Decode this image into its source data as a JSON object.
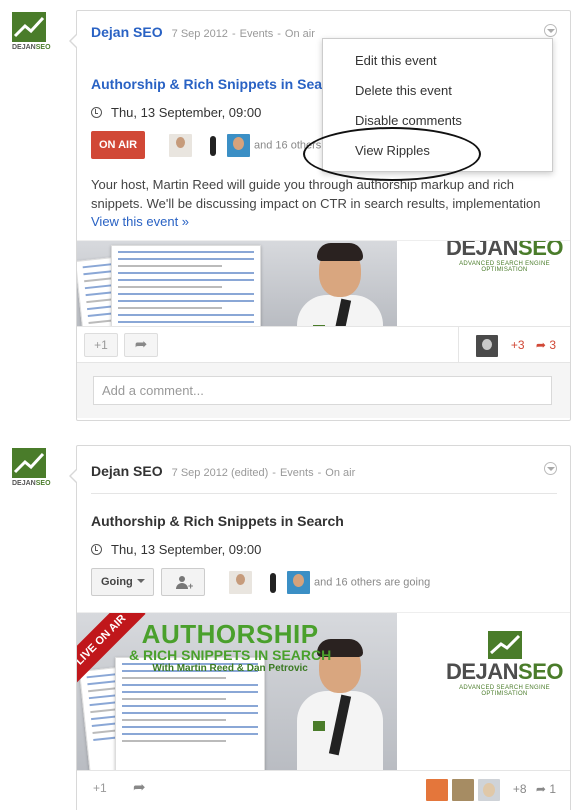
{
  "posts": [
    {
      "logo_text_a": "DEJAN",
      "logo_text_b": "SEO",
      "author": "Dejan SEO",
      "date": "7 Sep 2012",
      "category": "Events",
      "status": "On air",
      "title": "Authorship & Rich Snippets in Search",
      "when": "Thu, 13 September, 09:00",
      "action_label": "ON AIR",
      "attendees_text": "and 16 others",
      "description": "Your host, Martin Reed will guide you through authorship markup and rich snippets. We'll be discussing impact on CTR in search results, implementation",
      "view_link": "View this event »",
      "brand_a": "DEJAN",
      "brand_b": "SEO",
      "brand_sub": "ADVANCED SEARCH ENGINE OPTIMISATION",
      "plus_one": "+1",
      "plus_count": "+3",
      "share_count": "3",
      "comment_placeholder": "Add a comment...",
      "menu": [
        "Edit this event",
        "Delete this event",
        "Disable comments",
        "View Ripples"
      ]
    },
    {
      "logo_text_a": "DEJAN",
      "logo_text_b": "SEO",
      "author": "Dejan SEO",
      "date": "7 Sep 2012 (edited)",
      "category": "Events",
      "status": "On air",
      "title": "Authorship & Rich Snippets in Search",
      "when": "Thu, 13 September, 09:00",
      "going_label": "Going",
      "attendees_text": "and 16 others are going",
      "live_label": "LIVE ON AIR",
      "headline_1": "AUTHORSHIP",
      "headline_2": "& RICH SNIPPETS IN SEARCH",
      "headline_3": "With Martin Reed & Dan Petrovic",
      "brand_a": "DEJAN",
      "brand_b": "SEO",
      "brand_sub": "ADVANCED SEARCH ENGINE OPTIMISATION",
      "plus_one": "+1",
      "plus_count": "+8",
      "share_count": "1"
    }
  ],
  "colors": {
    "link": "#2962c4",
    "onair": "#d14836",
    "brand": "#4a7c2a"
  }
}
